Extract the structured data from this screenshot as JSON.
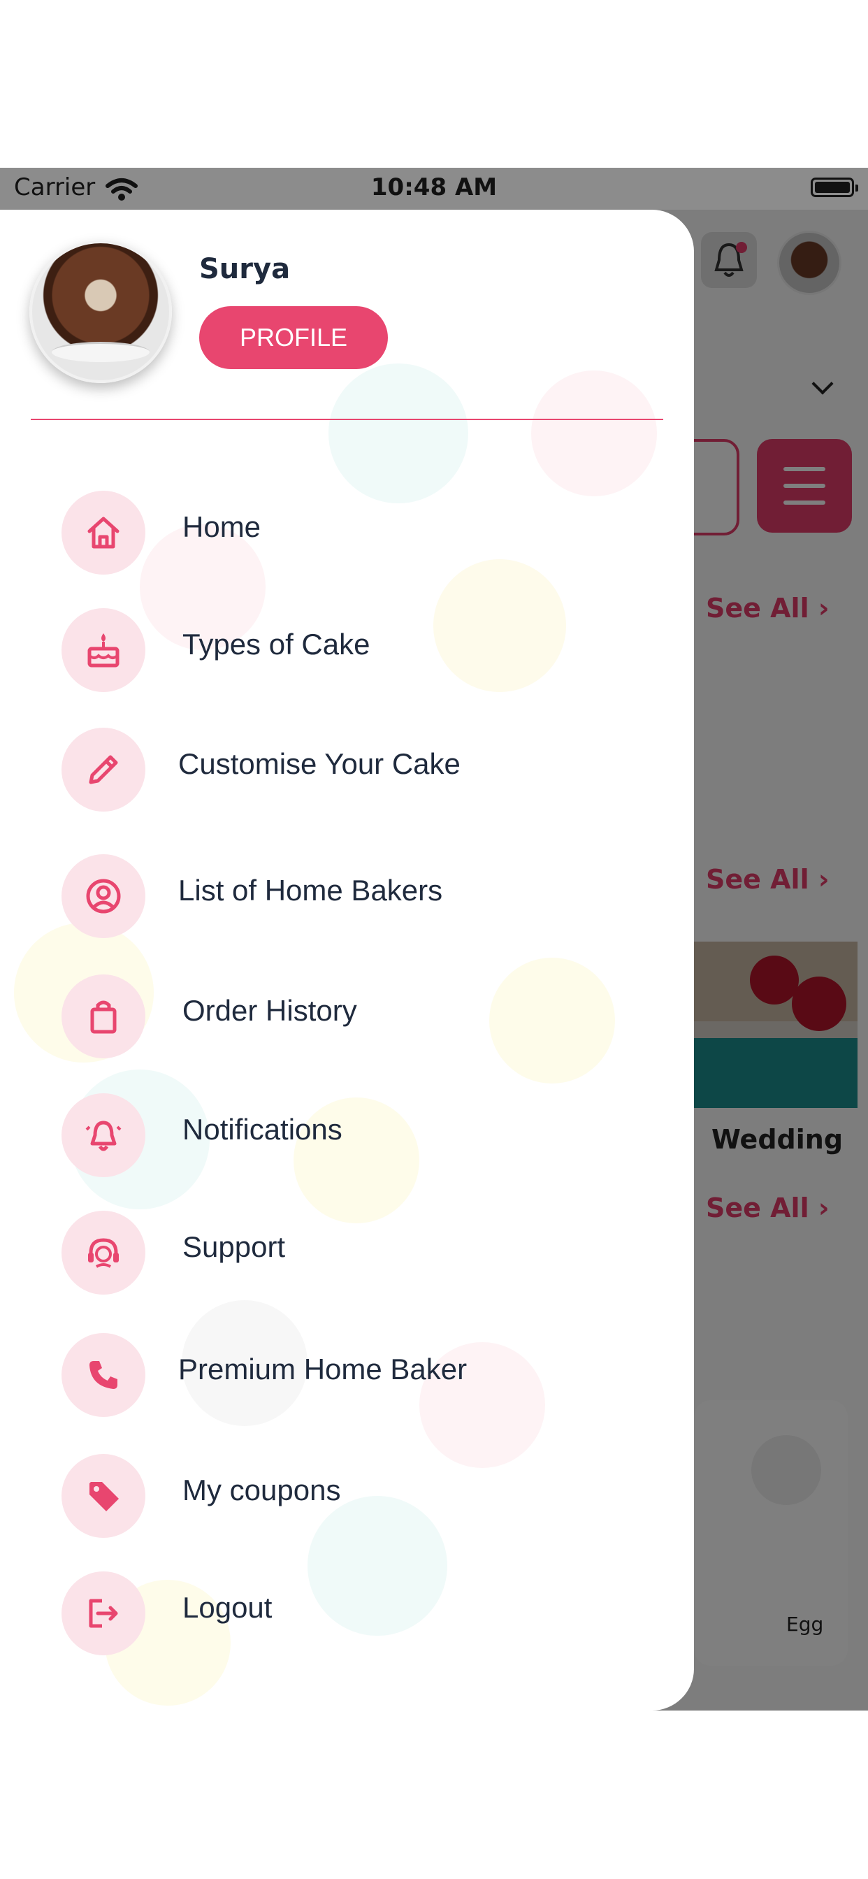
{
  "status_bar": {
    "carrier": "Carrier",
    "time": "10:48 AM"
  },
  "background_screen": {
    "see_all_label": "See All",
    "card_title": "Wedding",
    "tag": "Egg"
  },
  "drawer": {
    "user_name": "Surya",
    "profile_button": "PROFILE",
    "menu": [
      {
        "label": "Home",
        "icon": "home-icon"
      },
      {
        "label": "Types of Cake",
        "icon": "cake-icon"
      },
      {
        "label": "Customise Your Cake",
        "icon": "pencil-icon"
      },
      {
        "label": "List of Home Bakers",
        "icon": "user-circle-icon"
      },
      {
        "label": "Order History",
        "icon": "shopping-bag-icon"
      },
      {
        "label": "Notifications",
        "icon": "bell-icon"
      },
      {
        "label": "Support",
        "icon": "support-icon"
      },
      {
        "label": "Premium Home Baker",
        "icon": "phone-icon"
      },
      {
        "label": "My coupons",
        "icon": "tag-icon"
      },
      {
        "label": "Logout",
        "icon": "logout-icon"
      }
    ]
  },
  "colors": {
    "accent": "#e8466f",
    "icon_bg": "#fbe3e9",
    "text": "#1f2a3d"
  }
}
